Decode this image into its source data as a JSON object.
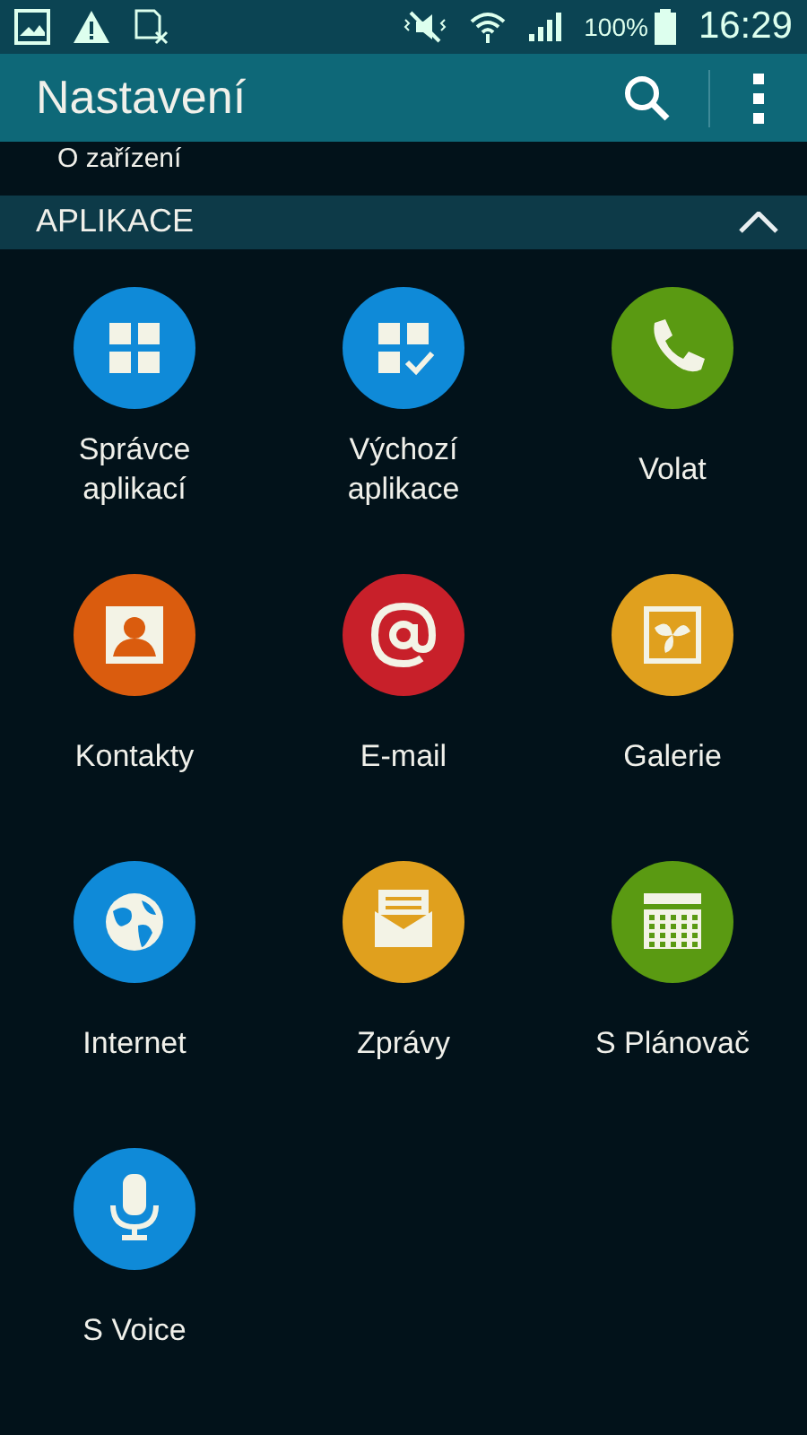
{
  "status_bar": {
    "battery": "100%",
    "time": "16:29"
  },
  "app_bar": {
    "title": "Nastavení"
  },
  "partial_item": {
    "label": "O zařízení"
  },
  "section": {
    "title": "APLIKACE",
    "expanded": true
  },
  "apps": [
    {
      "label": "Správce aplikací",
      "kind": "grid",
      "color": "#0f8ad8"
    },
    {
      "label": "Výchozí aplikace",
      "kind": "gridcheck",
      "color": "#0f8ad8"
    },
    {
      "label": "Volat",
      "kind": "phone",
      "color": "#5a9a12"
    },
    {
      "label": "Kontakty",
      "kind": "contact",
      "color": "#da5c0e"
    },
    {
      "label": "E-mail",
      "kind": "at",
      "color": "#c8202a"
    },
    {
      "label": "Galerie",
      "kind": "gallery",
      "color": "#e0a01e"
    },
    {
      "label": "Internet",
      "kind": "globe",
      "color": "#0f8ad8"
    },
    {
      "label": "Zprávy",
      "kind": "envelope",
      "color": "#e0a01e"
    },
    {
      "label": "S Plánovač",
      "kind": "calendar",
      "color": "#5a9a12"
    },
    {
      "label": "S Voice",
      "kind": "mic",
      "color": "#0f8ad8"
    }
  ]
}
